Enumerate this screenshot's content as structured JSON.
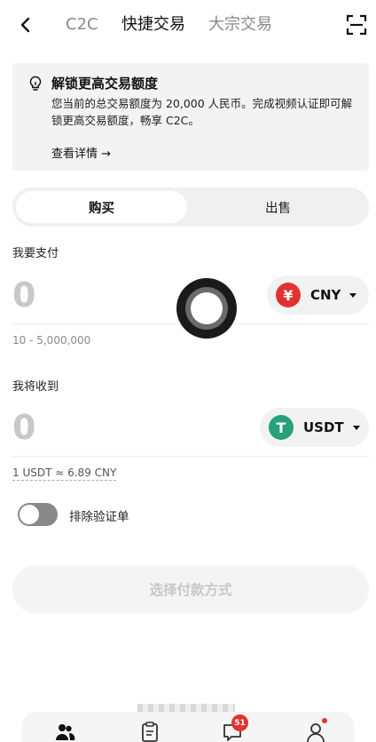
{
  "header": {
    "back_icon": "chevron-left-icon",
    "tabs": [
      {
        "label": "C2C",
        "active": false
      },
      {
        "label": "快捷交易",
        "active": true
      },
      {
        "label": "大宗交易",
        "active": false
      }
    ],
    "scan_icon": "scan-icon"
  },
  "banner": {
    "icon": "lightbulb-icon",
    "title": "解锁更高交易额度",
    "body": "您当前的总交易额度为 20,000 人民币。完成视频认证即可解锁更高交易额度，畅享 C2C。",
    "link": "查看详情 →"
  },
  "side_toggle": {
    "buy": "购买",
    "sell": "出售",
    "selected": "buy"
  },
  "pay": {
    "label": "我要支付",
    "value": "0",
    "currency": "CNY",
    "currency_symbol": "¥",
    "currency_color": "#e0332f",
    "range": "10 - 5,000,000"
  },
  "receive": {
    "label": "我将收到",
    "value": "0",
    "currency": "USDT",
    "currency_symbol": "T",
    "currency_color": "#26a17b"
  },
  "rate": "1 USDT ≈ 6.89 CNY",
  "exclude_verified": {
    "label": "排除验证单",
    "on": false
  },
  "cta": {
    "label": "选择付款方式"
  },
  "bottom_nav": {
    "items": [
      {
        "icon": "users-icon"
      },
      {
        "icon": "orders-icon"
      },
      {
        "icon": "chat-icon",
        "badge": "51"
      },
      {
        "icon": "profile-icon",
        "dot": true
      }
    ]
  }
}
